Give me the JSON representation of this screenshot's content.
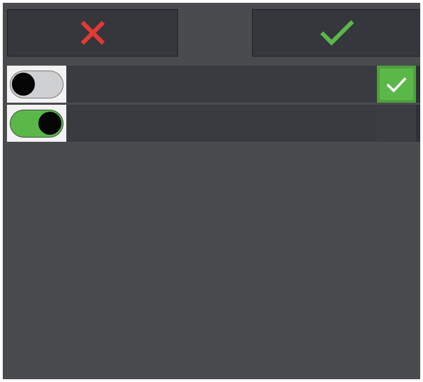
{
  "toolbar": {
    "cancel_icon": "close-icon",
    "confirm_icon": "check-icon"
  },
  "rows": [
    {
      "toggle_on": false,
      "checked": true
    },
    {
      "toggle_on": true,
      "checked": false
    }
  ],
  "colors": {
    "cancel": "#e53935",
    "confirm": "#5ab848",
    "toggle_on": "#5ab848",
    "toggle_off": "#cfd0d2",
    "checkbox_checked": "#5ab848",
    "background": "#4a4b4f"
  }
}
